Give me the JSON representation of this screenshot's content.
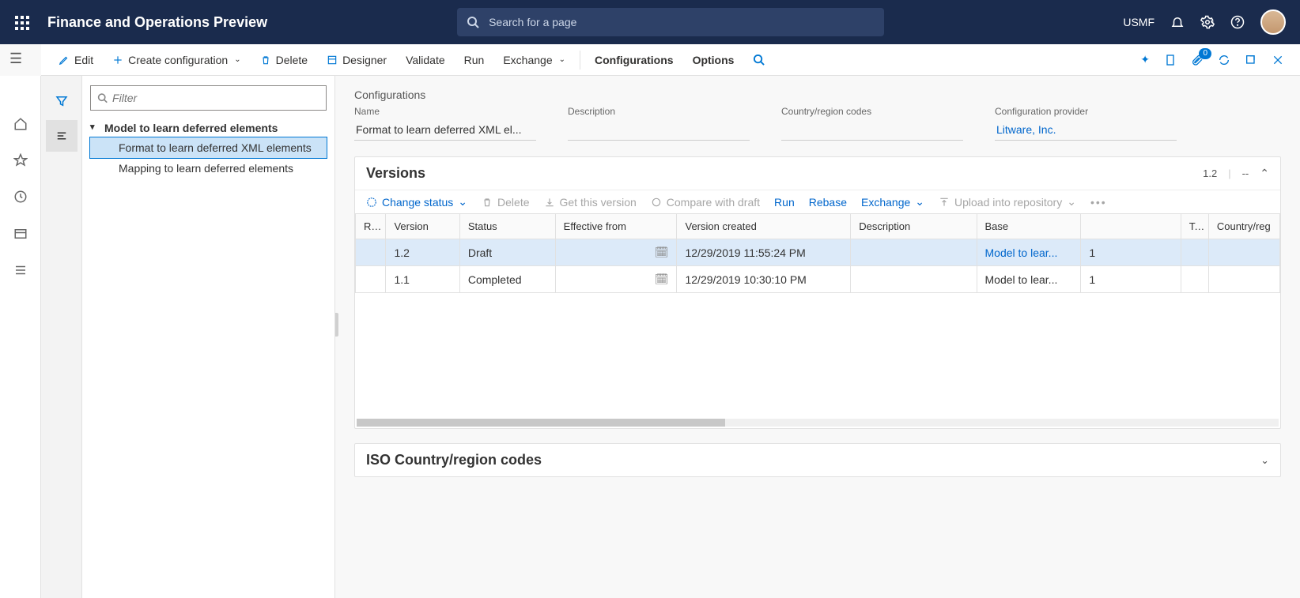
{
  "header": {
    "title": "Finance and Operations Preview",
    "search_placeholder": "Search for a page",
    "environment": "USMF"
  },
  "commands": {
    "edit": "Edit",
    "create": "Create configuration",
    "delete": "Delete",
    "designer": "Designer",
    "validate": "Validate",
    "run": "Run",
    "exchange": "Exchange",
    "configurations": "Configurations",
    "options": "Options",
    "attachments_badge": "0"
  },
  "tree": {
    "filter_placeholder": "Filter",
    "root": "Model to learn deferred elements",
    "children": [
      "Format to learn deferred XML elements",
      "Mapping to learn deferred elements"
    ],
    "selected_index": 0
  },
  "config": {
    "heading": "Configurations",
    "labels": {
      "name": "Name",
      "description": "Description",
      "country": "Country/region codes",
      "provider": "Configuration provider"
    },
    "name": "Format to learn deferred XML el...",
    "description": "",
    "country": "",
    "provider": "Litware, Inc."
  },
  "versions": {
    "title": "Versions",
    "current": "1.2",
    "current_extra": "--",
    "toolbar": {
      "change_status": "Change status",
      "delete": "Delete",
      "get_version": "Get this version",
      "compare": "Compare with draft",
      "run": "Run",
      "rebase": "Rebase",
      "exchange": "Exchange",
      "upload": "Upload into repository"
    },
    "columns": [
      "R...",
      "Version",
      "Status",
      "Effective from",
      "Version created",
      "Description",
      "Base",
      "",
      "T...",
      "Country/reg"
    ],
    "rows": [
      {
        "version": "1.2",
        "status": "Draft",
        "effective": "",
        "created": "12/29/2019 11:55:24 PM",
        "description": "",
        "base": "Model to lear...",
        "base_n": "1",
        "selected": true
      },
      {
        "version": "1.1",
        "status": "Completed",
        "effective": "",
        "created": "12/29/2019 10:30:10 PM",
        "description": "",
        "base": "Model to lear...",
        "base_n": "1",
        "selected": false
      }
    ]
  },
  "iso_section": {
    "title": "ISO Country/region codes"
  }
}
